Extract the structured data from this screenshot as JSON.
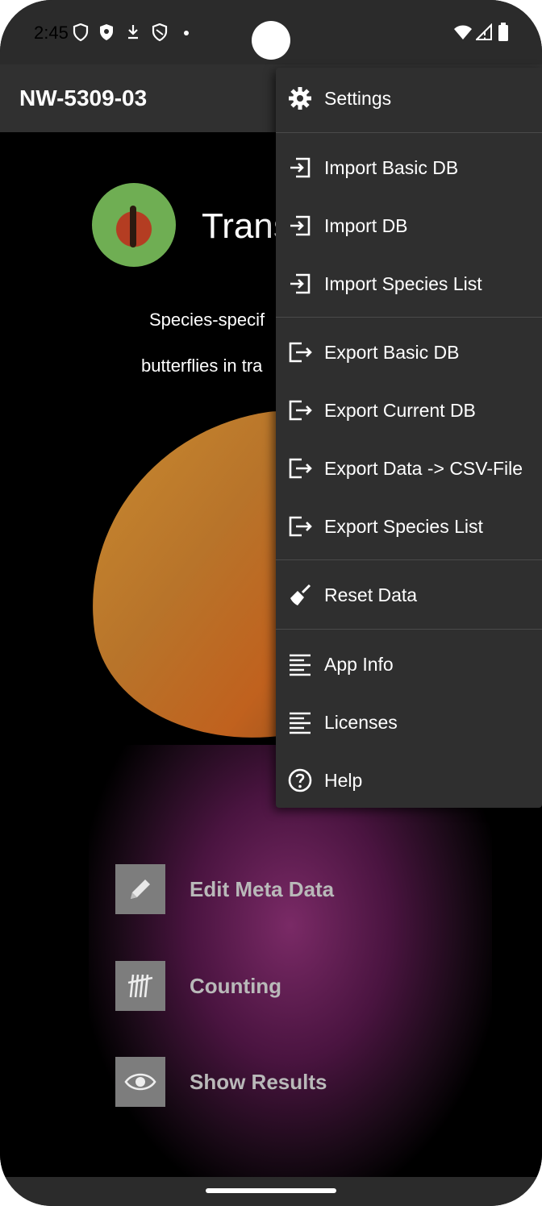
{
  "status_bar": {
    "time": "2:45",
    "icons": [
      "shield-outline-icon",
      "shield-filled-icon",
      "download-icon",
      "shield-slash-icon",
      "dot-icon"
    ],
    "right_icons": [
      "wifi-icon",
      "signal-icon",
      "battery-icon"
    ]
  },
  "app_bar": {
    "title": "NW-5309-03"
  },
  "main": {
    "hero_title": "Trans",
    "description_line1": "Species-specif",
    "description_line2": "butterflies in tra",
    "actions": [
      {
        "label": "Edit Meta Data",
        "icon": "pencil-icon"
      },
      {
        "label": "Counting",
        "icon": "tally-icon"
      },
      {
        "label": "Show Results",
        "icon": "eye-icon"
      }
    ]
  },
  "overflow_menu": {
    "items": [
      {
        "label": "Settings",
        "icon": "gear-icon"
      },
      {
        "label": "Import Basic DB",
        "icon": "import-icon"
      },
      {
        "label": "Import DB",
        "icon": "import-icon"
      },
      {
        "label": "Import Species List",
        "icon": "import-icon"
      },
      {
        "label": "Export Basic DB",
        "icon": "export-icon"
      },
      {
        "label": "Export Current DB",
        "icon": "export-icon"
      },
      {
        "label": "Export Data -> CSV-File",
        "icon": "export-icon"
      },
      {
        "label": "Export Species List",
        "icon": "export-icon"
      },
      {
        "label": "Reset Data",
        "icon": "broom-icon"
      },
      {
        "label": "App Info",
        "icon": "text-lines-icon"
      },
      {
        "label": "Licenses",
        "icon": "text-lines-icon"
      },
      {
        "label": "Help",
        "icon": "help-circle-icon"
      }
    ]
  },
  "colors": {
    "menu_bg": "#2f2f2f",
    "app_bar_bg": "#303030",
    "action_icon_bg": "#7d7d7d",
    "action_label": "#b9b9b9"
  }
}
